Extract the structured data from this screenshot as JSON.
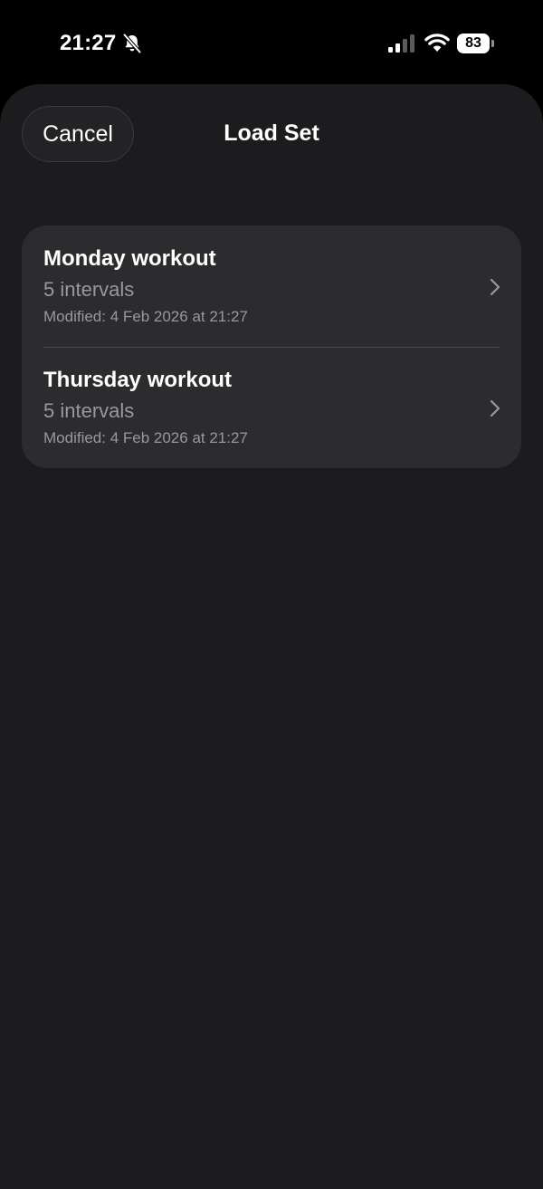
{
  "status_bar": {
    "time": "21:27",
    "battery_level": "83",
    "icons": [
      "bell-slash-icon",
      "cellular-signal-icon",
      "wifi-icon",
      "battery-icon"
    ]
  },
  "sheet": {
    "title": "Load Set",
    "cancel_label": "Cancel"
  },
  "sets": [
    {
      "name": "Monday workout",
      "intervals": "5 intervals",
      "modified": "Modified: 4 Feb 2026 at 21:27"
    },
    {
      "name": "Thursday workout",
      "intervals": "5 intervals",
      "modified": "Modified: 4 Feb 2026 at 21:27"
    }
  ],
  "colors": {
    "background": "#000000",
    "sheet": "#1c1c1e",
    "card": "#2c2c2e",
    "secondary_text": "#98989e",
    "separator": "#48484a"
  }
}
